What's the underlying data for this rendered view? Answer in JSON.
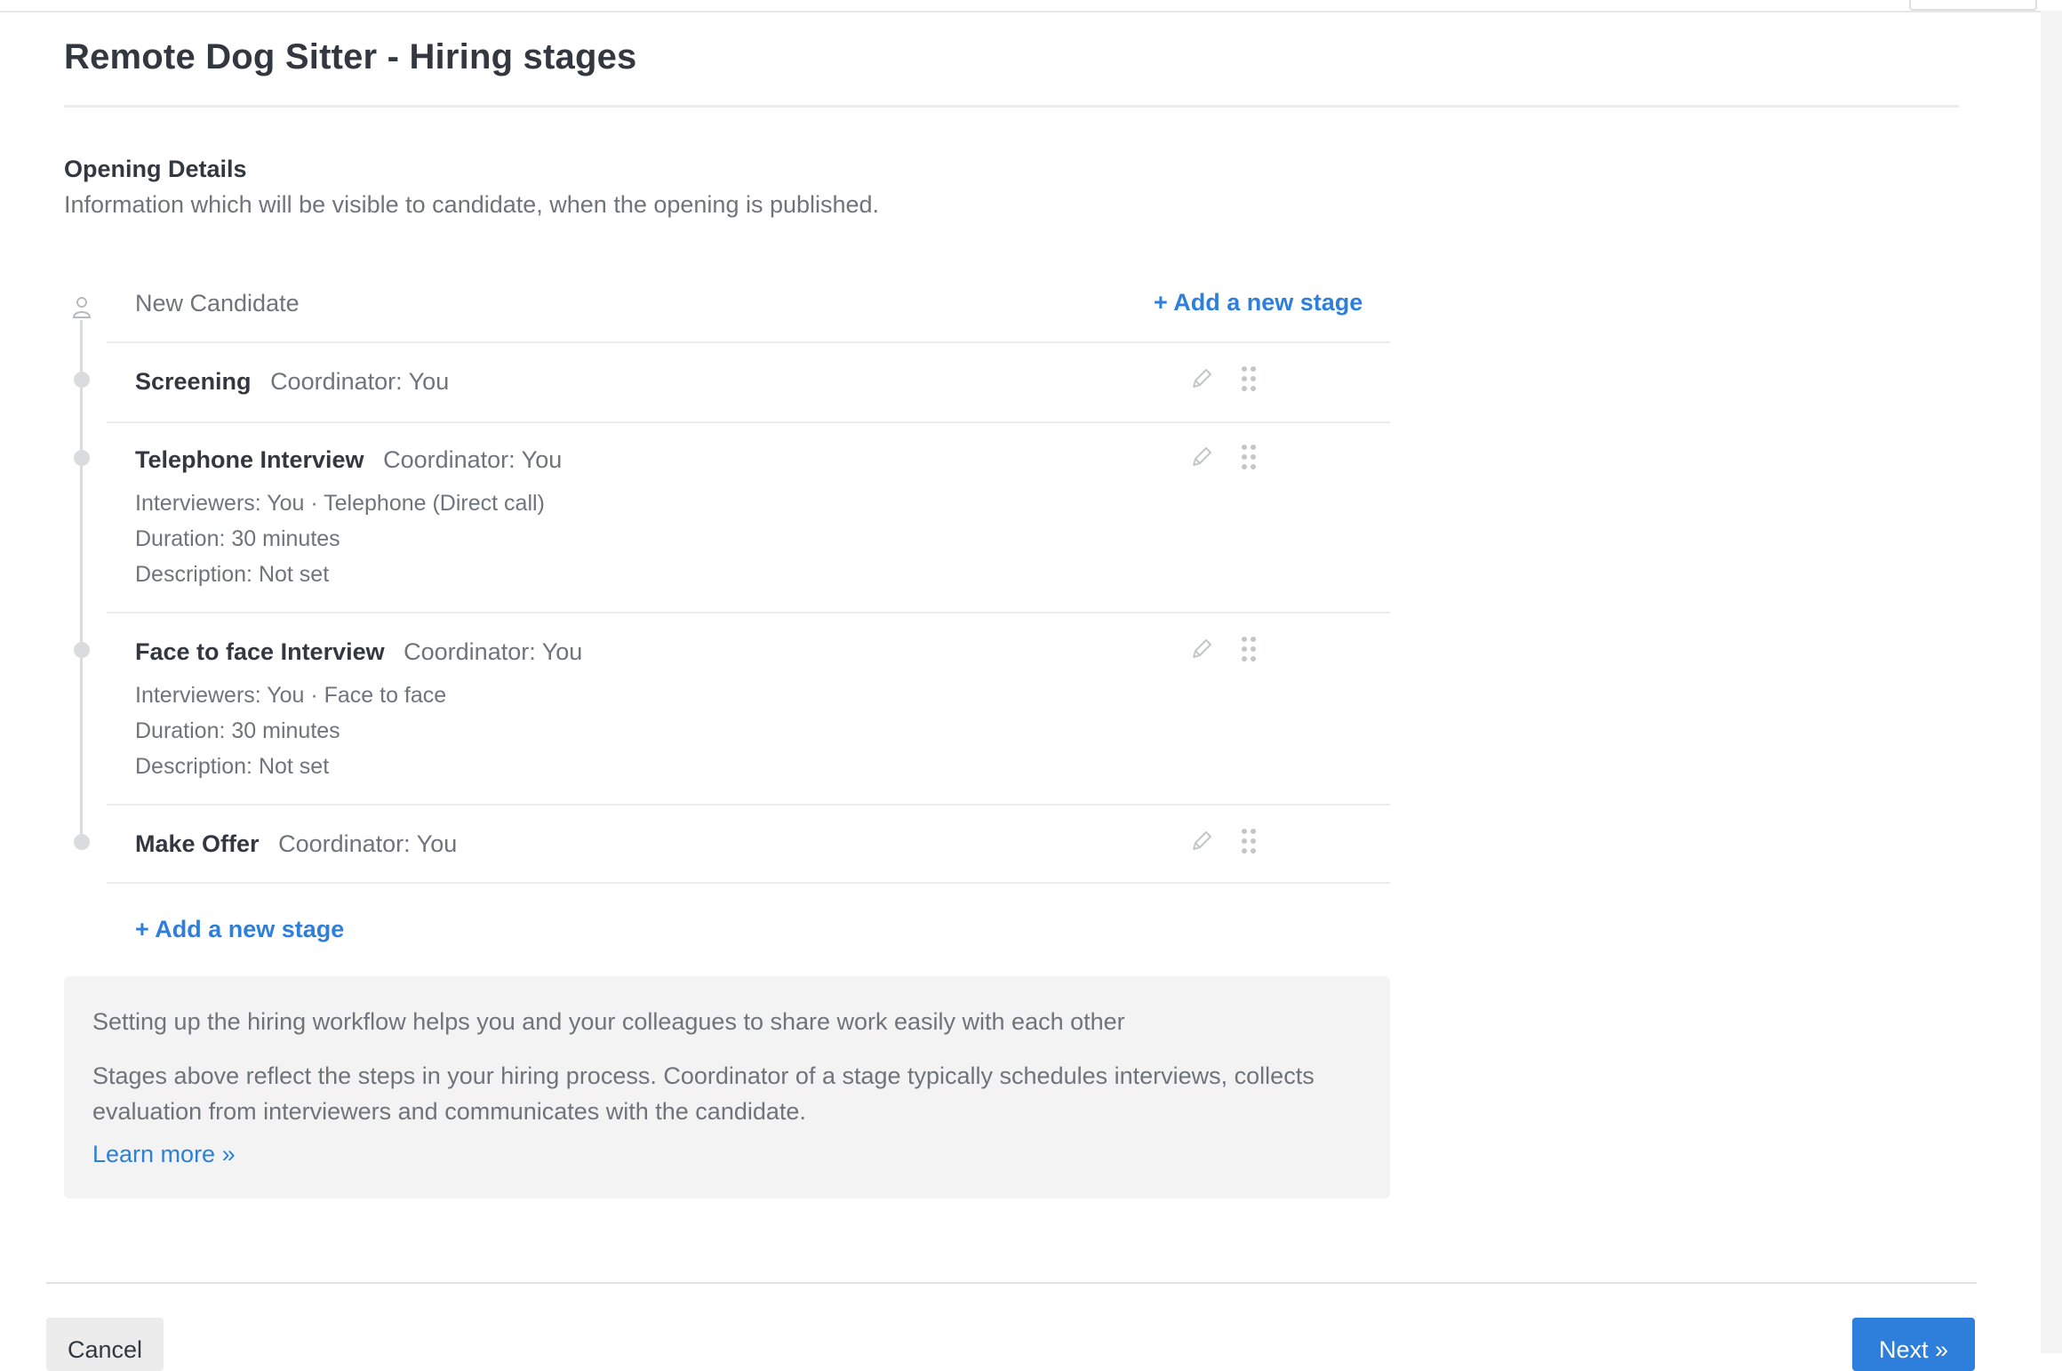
{
  "page": {
    "title": "Remote Dog Sitter - Hiring stages"
  },
  "opening": {
    "heading": "Opening Details",
    "subtitle": "Information which will be visible to candidate, when the opening is published."
  },
  "pipeline": {
    "first_stage": "New Candidate",
    "add_stage_label": "+ Add a new stage",
    "stages": [
      {
        "name": "Screening",
        "coordinator": "Coordinator: You",
        "details": []
      },
      {
        "name": "Telephone Interview",
        "coordinator": "Coordinator: You",
        "details": [
          "Interviewers: You · Telephone (Direct call)",
          "Duration: 30 minutes",
          "Description: Not set"
        ]
      },
      {
        "name": "Face to face Interview",
        "coordinator": "Coordinator: You",
        "details": [
          "Interviewers: You · Face to face",
          "Duration: 30 minutes",
          "Description: Not set"
        ]
      },
      {
        "name": "Make Offer",
        "coordinator": "Coordinator: You",
        "details": []
      }
    ]
  },
  "info": {
    "line1": "Setting up the hiring workflow helps you and your colleagues to share work easily with each other",
    "line2": "Stages above reflect the steps in your hiring process. Coordinator of a stage typically schedules interviews, collects evaluation from interviewers and communicates with the candidate.",
    "learn_more": "Learn more »"
  },
  "footer": {
    "cancel_label": "Cancel",
    "next_label": "Next »"
  },
  "icons": {
    "candidate": "person-icon",
    "edit": "pencil-icon",
    "reorder": "drag-handle-icon"
  },
  "colors": {
    "accent": "#2e7fdc",
    "text": "#333840",
    "muted": "#6f747b",
    "panel": "#f3f3f4"
  }
}
